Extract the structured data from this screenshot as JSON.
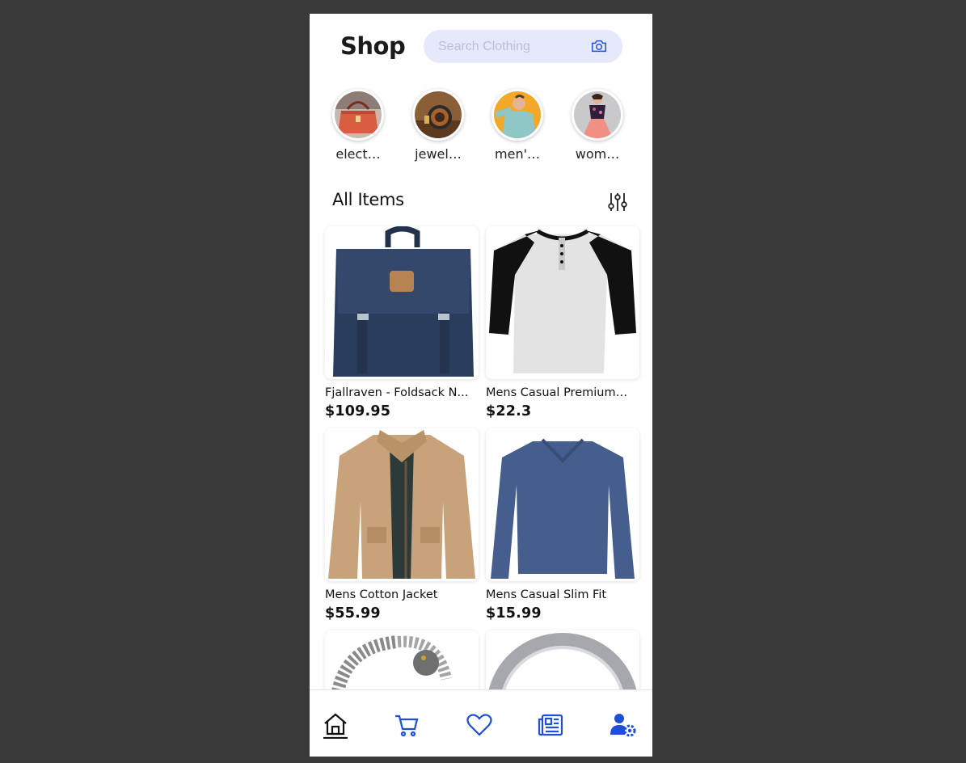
{
  "header": {
    "title": "Shop",
    "search_placeholder": "Search Clothing"
  },
  "categories": [
    {
      "label": "elect…",
      "icon": "handbag-photo"
    },
    {
      "label": "jewel…",
      "icon": "watch-photo"
    },
    {
      "label": "men'…",
      "icon": "man-shirt-photo"
    },
    {
      "label": "wom…",
      "icon": "woman-dress-photo"
    }
  ],
  "section": {
    "title": "All Items",
    "filter_icon": "sliders-icon"
  },
  "products": [
    {
      "name": "Fjallraven - Foldsack N...",
      "price": "$109.95",
      "image": "backpack"
    },
    {
      "name": "Mens Casual Premium ...",
      "price": "$22.3",
      "image": "raglan-tshirt"
    },
    {
      "name": "Mens Cotton Jacket",
      "price": "$55.99",
      "image": "jacket"
    },
    {
      "name": "Mens Casual Slim Fit",
      "price": "$15.99",
      "image": "long-sleeve-shirt"
    },
    {
      "name": "",
      "price": "",
      "image": "dragon-bracelet"
    },
    {
      "name": "",
      "price": "",
      "image": "silver-ring"
    }
  ],
  "bottom_nav": [
    {
      "icon": "home-icon",
      "active": true
    },
    {
      "icon": "cart-icon",
      "active": false
    },
    {
      "icon": "heart-icon",
      "active": false
    },
    {
      "icon": "news-icon",
      "active": false
    },
    {
      "icon": "user-settings-icon",
      "active": false
    }
  ],
  "colors": {
    "background": "#3a3a3a",
    "search_bg": "#e6e9fc",
    "accent": "#1d4fd8",
    "text": "#111111"
  }
}
